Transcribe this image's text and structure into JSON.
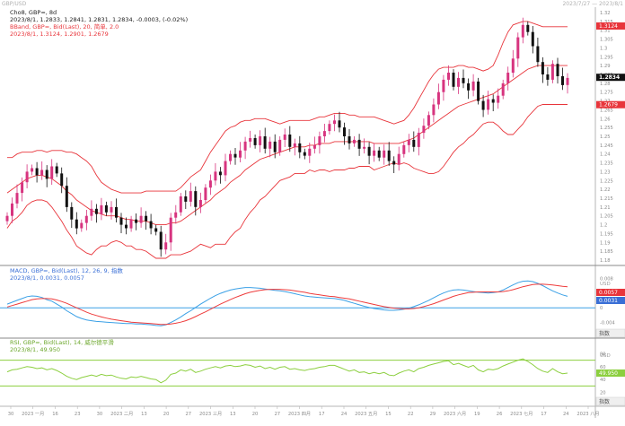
{
  "header": {
    "left_text": "GBP/USD",
    "right_text": "2023/7/27 — 2023/8/1"
  },
  "main_panel": {
    "symbol_line": "Cho8, GBP=, 8d",
    "ohlc_line": "2023/8/1, 1.2833, 1.2841, 1.2831, 1.2834, -0.0003, (-0.02%)",
    "bband_line": "BBand, GBP=, Bid(Last), 20, 简单, 2.0",
    "bband_values": "2023/8/1, 1.3124, 1.2901, 1.2679",
    "price_axis_unit": "USD",
    "price_axis_labels": [
      "1.32",
      "1.315",
      "1.31",
      "1.305",
      "1.3",
      "1.295",
      "1.29",
      "1.285",
      "1.28",
      "1.275",
      "1.27",
      "1.265",
      "1.26",
      "1.255",
      "1.25",
      "1.245",
      "1.24",
      "1.235",
      "1.23",
      "1.225",
      "1.22",
      "1.215",
      "1.21",
      "1.205",
      "1.2",
      "1.195",
      "1.19",
      "1.185",
      "1.18"
    ],
    "last_price_box": "1.2834",
    "upper_band_box": "1.3124",
    "mid_band_box": "1.2901",
    "lower_band_box": "1.2679"
  },
  "macd_panel": {
    "title_line": "MACD, GBP=, Bid(Last), 12, 26, 9, 指数",
    "values_line": "2023/8/1, 0.0031, 0.0057",
    "axis_unit": "USD",
    "axis_labels": [
      "0.008",
      "0.004",
      "0",
      "-0.004"
    ],
    "box_signal": "0.0057",
    "box_macd": "0.0031",
    "bottom_right_box": "指数"
  },
  "rsi_panel": {
    "title_line": "RSI, GBP=, Bid(Last), 14, 威尔德平滑",
    "values_line": "2023/8/1, 49.950",
    "axis_unit": "USD",
    "axis_labels": [
      "80",
      "60",
      "40",
      "20"
    ],
    "value_box": "49.950",
    "bottom_right_box": "指数"
  },
  "time_axis": {
    "labels": [
      "30",
      "2023 一月",
      "16",
      "23",
      "30",
      "2023 二月",
      "13",
      "20",
      "27",
      "2023 三月",
      "13",
      "20",
      "27",
      "2023 四月",
      "17",
      "24",
      "2023 五月",
      "15",
      "22",
      "29",
      "2023 六月",
      "19",
      "26",
      "2023 七月",
      "17",
      "24",
      "2023 八月"
    ]
  },
  "colors": {
    "bband": "#e8353b",
    "candle_up": "#d7347f",
    "candle_down": "#111111",
    "macd_line": "#3aa0e6",
    "signal_line": "#ee3b3b",
    "zero_line": "#3aa0e6",
    "rsi_line": "#8ccf3f",
    "rsi_band": "#8ccf3f",
    "grid_sep": "#8a8a8a",
    "last_box": "#111111",
    "band_box": "#e8353b",
    "macd_box": "#3a6fd6"
  },
  "chart_data": {
    "type": "candlestick",
    "instrument": "GBP=",
    "price_range": [
      1.18,
      1.32
    ],
    "x_labels": [
      "30",
      "2023 一月",
      "16",
      "23",
      "30",
      "2023 二月",
      "13",
      "20",
      "27",
      "2023 三月",
      "13",
      "20",
      "27",
      "2023 四月",
      "17",
      "24",
      "2023 五月",
      "15",
      "22",
      "29",
      "2023 六月",
      "19",
      "26",
      "2023 七月",
      "17",
      "24",
      "2023 八月"
    ],
    "close": [
      1.205,
      1.212,
      1.218,
      1.224,
      1.23,
      1.232,
      1.228,
      1.231,
      1.226,
      1.233,
      1.229,
      1.222,
      1.21,
      1.203,
      1.198,
      1.201,
      1.205,
      1.209,
      1.206,
      1.211,
      1.207,
      1.21,
      1.204,
      1.2,
      1.198,
      1.203,
      1.201,
      1.205,
      1.202,
      1.198,
      1.196,
      1.186,
      1.19,
      1.204,
      1.207,
      1.216,
      1.213,
      1.219,
      1.21,
      1.214,
      1.221,
      1.225,
      1.23,
      1.228,
      1.236,
      1.24,
      1.238,
      1.242,
      1.247,
      1.249,
      1.245,
      1.25,
      1.243,
      1.247,
      1.241,
      1.248,
      1.251,
      1.244,
      1.246,
      1.241,
      1.239,
      1.243,
      1.245,
      1.25,
      1.253,
      1.257,
      1.259,
      1.255,
      1.25,
      1.246,
      1.248,
      1.243,
      1.244,
      1.239,
      1.242,
      1.238,
      1.242,
      1.236,
      1.234,
      1.24,
      1.245,
      1.248,
      1.244,
      1.252,
      1.256,
      1.262,
      1.268,
      1.275,
      1.282,
      1.286,
      1.278,
      1.283,
      1.28,
      1.276,
      1.281,
      1.27,
      1.265,
      1.271,
      1.269,
      1.273,
      1.28,
      1.286,
      1.294,
      1.306,
      1.313,
      1.309,
      1.301,
      1.292,
      1.285,
      1.282,
      1.291,
      1.284,
      1.279,
      1.283
    ],
    "bband_upper": [
      1.238,
      1.238,
      1.24,
      1.241,
      1.241,
      1.241,
      1.242,
      1.242,
      1.241,
      1.242,
      1.242,
      1.242,
      1.241,
      1.241,
      1.24,
      1.238,
      1.236,
      1.233,
      1.228,
      1.224,
      1.222,
      1.22,
      1.219,
      1.218,
      1.218,
      1.218,
      1.218,
      1.218,
      1.219,
      1.219,
      1.219,
      1.219,
      1.219,
      1.219,
      1.219,
      1.221,
      1.224,
      1.227,
      1.229,
      1.231,
      1.236,
      1.241,
      1.245,
      1.249,
      1.253,
      1.255,
      1.256,
      1.258,
      1.259,
      1.259,
      1.26,
      1.26,
      1.26,
      1.259,
      1.258,
      1.257,
      1.258,
      1.259,
      1.259,
      1.259,
      1.259,
      1.259,
      1.26,
      1.261,
      1.261,
      1.262,
      1.263,
      1.263,
      1.263,
      1.262,
      1.262,
      1.261,
      1.261,
      1.261,
      1.261,
      1.26,
      1.259,
      1.258,
      1.257,
      1.258,
      1.259,
      1.262,
      1.266,
      1.271,
      1.276,
      1.281,
      1.285,
      1.288,
      1.289,
      1.289,
      1.289,
      1.29,
      1.29,
      1.289,
      1.289,
      1.288,
      1.287,
      1.288,
      1.29,
      1.296,
      1.303,
      1.309,
      1.313,
      1.314,
      1.315,
      1.315,
      1.314,
      1.313,
      1.312,
      1.312,
      1.312,
      1.312,
      1.312,
      1.312
    ],
    "bband_mid": [
      1.218,
      1.22,
      1.222,
      1.224,
      1.226,
      1.227,
      1.228,
      1.228,
      1.227,
      1.226,
      1.224,
      1.222,
      1.219,
      1.217,
      1.214,
      1.212,
      1.21,
      1.208,
      1.207,
      1.206,
      1.205,
      1.205,
      1.205,
      1.204,
      1.203,
      1.203,
      1.202,
      1.202,
      1.202,
      1.201,
      1.2,
      1.2,
      1.2,
      1.201,
      1.201,
      1.202,
      1.204,
      1.206,
      1.208,
      1.21,
      1.212,
      1.214,
      1.217,
      1.219,
      1.221,
      1.224,
      1.226,
      1.228,
      1.231,
      1.233,
      1.235,
      1.237,
      1.238,
      1.239,
      1.24,
      1.241,
      1.242,
      1.243,
      1.244,
      1.244,
      1.244,
      1.245,
      1.245,
      1.246,
      1.246,
      1.246,
      1.247,
      1.247,
      1.247,
      1.247,
      1.247,
      1.247,
      1.247,
      1.247,
      1.246,
      1.246,
      1.246,
      1.246,
      1.246,
      1.246,
      1.247,
      1.248,
      1.249,
      1.251,
      1.253,
      1.255,
      1.257,
      1.259,
      1.261,
      1.263,
      1.265,
      1.267,
      1.268,
      1.269,
      1.27,
      1.271,
      1.272,
      1.273,
      1.274,
      1.276,
      1.278,
      1.28,
      1.282,
      1.284,
      1.286,
      1.288,
      1.289,
      1.29,
      1.29,
      1.29,
      1.29,
      1.29,
      1.29,
      1.29
    ],
    "bband_lower": [
      1.198,
      1.202,
      1.204,
      1.207,
      1.211,
      1.213,
      1.214,
      1.214,
      1.213,
      1.21,
      1.206,
      1.202,
      1.197,
      1.193,
      1.188,
      1.186,
      1.184,
      1.183,
      1.186,
      1.188,
      1.188,
      1.19,
      1.191,
      1.19,
      1.188,
      1.188,
      1.186,
      1.186,
      1.185,
      1.183,
      1.181,
      1.181,
      1.181,
      1.183,
      1.183,
      1.183,
      1.184,
      1.185,
      1.187,
      1.189,
      1.188,
      1.187,
      1.189,
      1.189,
      1.189,
      1.193,
      1.196,
      1.198,
      1.203,
      1.207,
      1.21,
      1.214,
      1.216,
      1.219,
      1.222,
      1.225,
      1.226,
      1.227,
      1.229,
      1.229,
      1.229,
      1.231,
      1.23,
      1.231,
      1.231,
      1.23,
      1.231,
      1.231,
      1.231,
      1.232,
      1.232,
      1.233,
      1.233,
      1.233,
      1.231,
      1.232,
      1.233,
      1.234,
      1.235,
      1.234,
      1.235,
      1.234,
      1.232,
      1.231,
      1.23,
      1.229,
      1.229,
      1.23,
      1.233,
      1.237,
      1.241,
      1.244,
      1.246,
      1.249,
      1.251,
      1.254,
      1.257,
      1.258,
      1.258,
      1.256,
      1.253,
      1.251,
      1.251,
      1.254,
      1.257,
      1.261,
      1.264,
      1.267,
      1.268,
      1.268,
      1.268,
      1.268,
      1.268,
      1.268
    ],
    "macd": [
      0.001,
      0.0015,
      0.002,
      0.0025,
      0.003,
      0.0032,
      0.0031,
      0.0028,
      0.0022,
      0.0018,
      0.001,
      0.0002,
      -0.0008,
      -0.0016,
      -0.0024,
      -0.0029,
      -0.0033,
      -0.0035,
      -0.0037,
      -0.0038,
      -0.0039,
      -0.004,
      -0.0041,
      -0.0042,
      -0.0043,
      -0.0043,
      -0.0044,
      -0.0044,
      -0.0045,
      -0.0046,
      -0.0048,
      -0.0049,
      -0.0046,
      -0.004,
      -0.0033,
      -0.0025,
      -0.0016,
      -0.0008,
      0.0001,
      0.001,
      0.0018,
      0.0026,
      0.0033,
      0.0039,
      0.0044,
      0.0048,
      0.0051,
      0.0053,
      0.0055,
      0.0055,
      0.0054,
      0.0053,
      0.0051,
      0.0049,
      0.0047,
      0.0046,
      0.0044,
      0.0041,
      0.0038,
      0.0035,
      0.0032,
      0.003,
      0.0029,
      0.0028,
      0.0027,
      0.0026,
      0.0025,
      0.0023,
      0.002,
      0.0016,
      0.0012,
      0.0008,
      0.0004,
      0.0001,
      -0.0002,
      -0.0004,
      -0.0006,
      -0.0007,
      -0.0007,
      -0.0006,
      -0.0004,
      -0.0001,
      0.0003,
      0.0008,
      0.0014,
      0.002,
      0.0027,
      0.0034,
      0.004,
      0.0045,
      0.0048,
      0.0049,
      0.0048,
      0.0046,
      0.0044,
      0.0042,
      0.0041,
      0.004,
      0.0041,
      0.0043,
      0.0048,
      0.0055,
      0.0062,
      0.0068,
      0.0072,
      0.0073,
      0.0071,
      0.0066,
      0.006,
      0.0053,
      0.0046,
      0.004,
      0.0035,
      0.0031
    ],
    "signal": [
      0.0002,
      0.0006,
      0.001,
      0.0014,
      0.0018,
      0.0022,
      0.0024,
      0.0025,
      0.0025,
      0.0024,
      0.0021,
      0.0017,
      0.0012,
      0.0006,
      0.0,
      -0.0006,
      -0.0012,
      -0.0017,
      -0.0021,
      -0.0025,
      -0.0028,
      -0.0031,
      -0.0033,
      -0.0035,
      -0.0037,
      -0.0039,
      -0.004,
      -0.0041,
      -0.0042,
      -0.0043,
      -0.0044,
      -0.0045,
      -0.0045,
      -0.0044,
      -0.0042,
      -0.0039,
      -0.0035,
      -0.003,
      -0.0024,
      -0.0017,
      -0.0011,
      -0.0004,
      0.0003,
      0.001,
      0.0016,
      0.0022,
      0.0028,
      0.0033,
      0.0038,
      0.0042,
      0.0045,
      0.0047,
      0.0049,
      0.005,
      0.005,
      0.005,
      0.0049,
      0.0048,
      0.0046,
      0.0044,
      0.0042,
      0.0039,
      0.0037,
      0.0035,
      0.0033,
      0.0031,
      0.003,
      0.0028,
      0.0026,
      0.0024,
      0.0021,
      0.0018,
      0.0015,
      0.0012,
      0.0009,
      0.0006,
      0.0003,
      0.0001,
      -0.0001,
      -0.0002,
      -0.0003,
      -0.0003,
      -0.0002,
      0.0,
      0.0003,
      0.0007,
      0.0011,
      0.0016,
      0.0021,
      0.0026,
      0.0031,
      0.0035,
      0.0038,
      0.0041,
      0.0042,
      0.0043,
      0.0043,
      0.0043,
      0.0043,
      0.0043,
      0.0044,
      0.0046,
      0.0049,
      0.0053,
      0.0057,
      0.006,
      0.0063,
      0.0064,
      0.0064,
      0.0063,
      0.0062,
      0.006,
      0.0058,
      0.0057
    ],
    "rsi": [
      52,
      55,
      56,
      58,
      60,
      59,
      57,
      58,
      55,
      57,
      54,
      50,
      45,
      42,
      40,
      43,
      45,
      47,
      45,
      48,
      46,
      47,
      44,
      42,
      41,
      44,
      43,
      45,
      43,
      41,
      40,
      35,
      39,
      48,
      50,
      55,
      53,
      56,
      51,
      53,
      56,
      58,
      60,
      58,
      61,
      62,
      60,
      61,
      63,
      62,
      59,
      61,
      57,
      59,
      56,
      59,
      60,
      56,
      57,
      55,
      54,
      56,
      57,
      59,
      60,
      62,
      62,
      59,
      56,
      53,
      55,
      51,
      52,
      49,
      51,
      49,
      51,
      47,
      46,
      50,
      53,
      55,
      52,
      57,
      59,
      62,
      64,
      66,
      68,
      69,
      63,
      65,
      62,
      59,
      62,
      55,
      52,
      56,
      55,
      57,
      61,
      64,
      67,
      70,
      72,
      68,
      63,
      57,
      53,
      51,
      57,
      52,
      49,
      50
    ]
  }
}
